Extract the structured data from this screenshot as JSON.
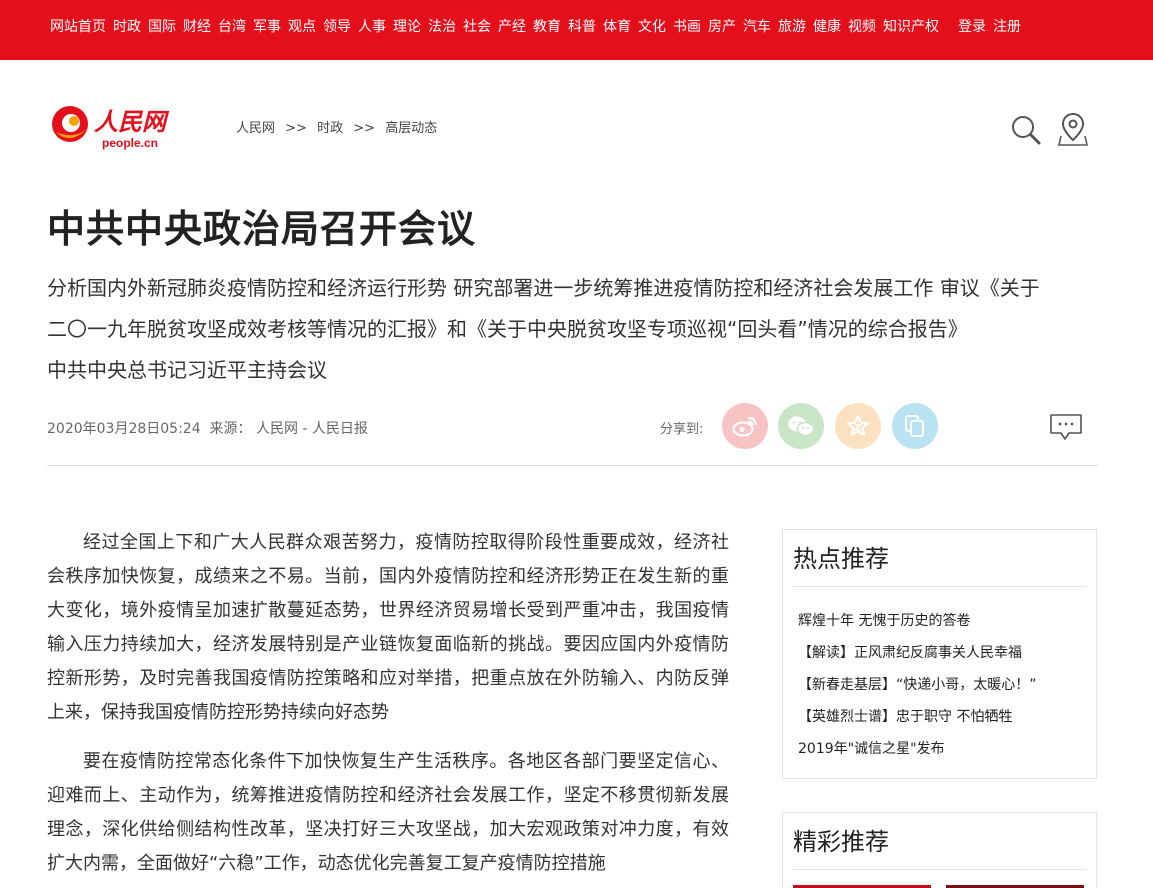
{
  "nav": {
    "items": [
      "网站首页",
      "时政",
      "国际",
      "财经",
      "台湾",
      "军事",
      "观点",
      "领导",
      "人事",
      "理论",
      "法治",
      "社会",
      "产经",
      "教育",
      "科普",
      "体育",
      "文化",
      "书画",
      "房产",
      "汽车",
      "旅游",
      "健康",
      "视频",
      "知识产权"
    ],
    "login": "登录",
    "register": "注册"
  },
  "logo": {
    "cn": "人民网",
    "en": "people.cn"
  },
  "breadcrumb": {
    "items": [
      "人民网",
      "时政",
      "高层动态"
    ],
    "separator": ">>"
  },
  "article": {
    "title": "中共中央政治局召开会议",
    "subtitle_lines": [
      "分析国内外新冠肺炎疫情防控和经济运行形势 研究部署进一步统筹推进疫情防控和经济社会发展工作 审议《关于",
      "二〇一九年脱贫攻坚成效考核等情况的汇报》和《关于中央脱贫攻坚专项巡视“回头看”情况的综合报告》",
      "中共中央总书记习近平主持会议"
    ],
    "date": "2020年03月28日05:24",
    "source_label": "来源：",
    "source": "人民网 - 人民日报",
    "share_label": "分享到:",
    "paragraphs": [
      "经过全国上下和广大人民群众艰苦努力，疫情防控取得阶段性重要成效，经济社会秩序加快恢复，成绩来之不易。当前，国内外疫情防控和经济形势正在发生新的重大变化，境外疫情呈加速扩散蔓延态势，世界经济贸易增长受到严重冲击，我国疫情输入压力持续加大，经济发展特别是产业链恢复面临新的挑战。要因应国内外疫情防控新形势，及时完善我国疫情防控策略和应对举措，把重点放在外防输入、内防反弹上来，保持我国疫情防控形势持续向好态势",
      "要在疫情防控常态化条件下加快恢复生产生活秩序。各地区各部门要坚定信心、迎难而上、主动作为，统筹推进疫情防控和经济社会发展工作，坚定不移贯彻新发展理念，深化供给侧结构性改革，坚决打好三大攻坚战，加大宏观政策对冲力度，有效扩大内需，全面做好“六稳”工作，动态优化完善复工复产疫情防控措施"
    ]
  },
  "sidebar": {
    "hot_title": "热点推荐",
    "hot_items": [
      "辉煌十年 无愧于历史的答卷",
      "【解读】正风肃纪反腐事关人民幸福",
      "【新春走基层】“快递小哥，太暖心！”",
      "【英雄烈士谱】忠于职守 不怕牺牲",
      "2019年\"诚信之星\"发布"
    ],
    "featured_title": "精彩推荐"
  },
  "colors": {
    "brand_red": "#e50f1c",
    "weibo": "#f7c3c3",
    "wechat": "#c8e6c6",
    "qzone": "#fbe1bf",
    "copy": "#b9e2f3"
  }
}
